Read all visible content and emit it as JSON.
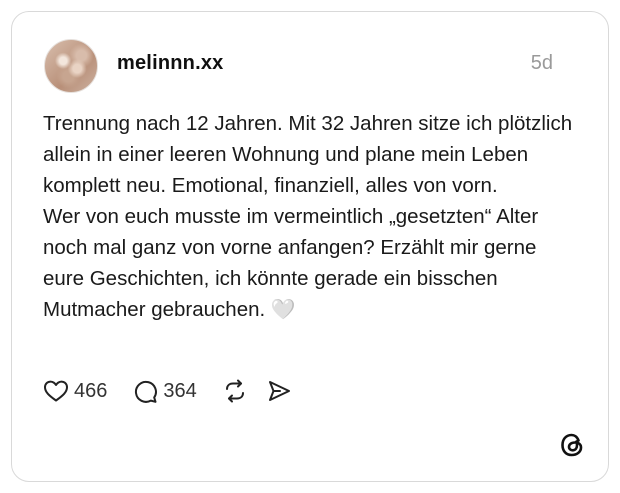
{
  "post": {
    "username": "melinnn.xx",
    "time": "5d",
    "paragraphs": [
      "Trennung nach 12 Jahren. Mit 32 Jahren sitze ich plötzlich allein in einer leeren Wohnung und plane mein Leben komplett neu. Emotional, finanziell, alles von vorn.",
      "Wer von euch musste im vermeintlich „gesetzten“ Alter noch mal ganz von vorne anfangen? Erzählt mir gerne eure Geschichten, ich könnte gerade ein bisschen Mutmacher gebrauchen."
    ],
    "emoji": "🤍"
  },
  "actions": {
    "likes": "466",
    "comments": "364"
  },
  "icons": {
    "like": "heart-icon",
    "comment": "comment-bubble-icon",
    "repost": "repost-icon",
    "share": "share-send-icon",
    "brand": "threads-logo-icon"
  }
}
